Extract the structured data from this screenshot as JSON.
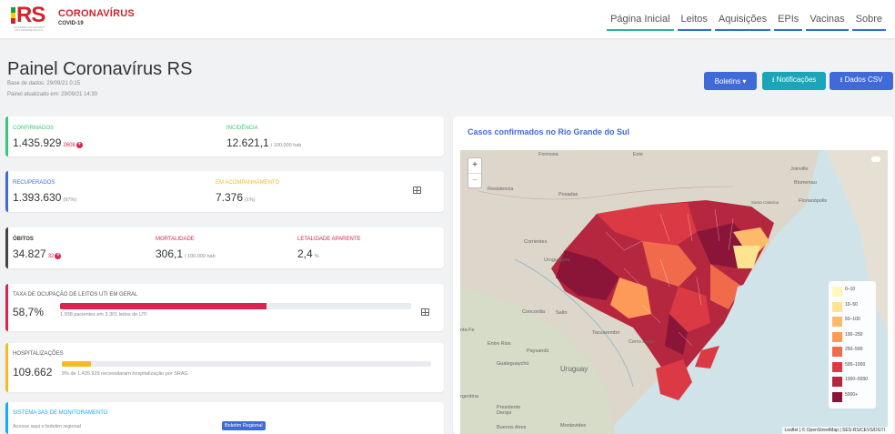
{
  "header": {
    "logo_text": "RS",
    "logo_sub": "GOVERNO DO ESTADO RIO GRANDE DO SUL",
    "brand_title": "CORONAVÍRUS",
    "brand_sub": "COVID-19",
    "nav": [
      "Página Inicial",
      "Leitos",
      "Aquisições",
      "EPIs",
      "Vacinas",
      "Sobre"
    ],
    "active_nav": "Página Inicial"
  },
  "page": {
    "title": "Painel Coronavírus RS",
    "base_dados": "Base de dados: 29/09/21 0:15",
    "atualizado": "Painel atualizado em: 29/09/21 14:30"
  },
  "buttons": {
    "boletins": "Boletins ▾",
    "notificacoes": "⭳ Notificações",
    "dados_csv": "⭳ Dados CSV"
  },
  "cards": {
    "confirmados": {
      "label": "CONFIRMADOS",
      "value": "1.435.929",
      "increment": "2608"
    },
    "incidencia": {
      "label": "INCIDÊNCIA",
      "value": "12.621,1",
      "unit": "/ 100.000 hab"
    },
    "recuperados": {
      "label": "RECUPERADOS",
      "value": "1.393.630",
      "pct": "(97%)"
    },
    "acompanhamento": {
      "label": "EM ACOMPANHAMENTO",
      "value": "7.376",
      "pct": "(1%)"
    },
    "obitos": {
      "label": "ÓBITOS",
      "value": "34.827",
      "increment": "32"
    },
    "mortalidade": {
      "label": "MORTALIDADE",
      "value": "306,1",
      "unit": "/ 100.000 hab"
    },
    "letalidade": {
      "label": "LETALIDADE APARENTE",
      "value": "2,4",
      "unit": "%"
    },
    "uti": {
      "label": "TAXA DE OCUPAÇÃO DE LEITOS UTI EM GERAL",
      "value": "58,7%",
      "desc": "1.938 pacientes em 3.301 leitos de UTI",
      "fill": 0.587
    },
    "hosp": {
      "label": "HOSPITALIZAÇÕES",
      "value": "109.662",
      "desc": "8% de 1.435.929 necessitaram hospitalização por SRAG",
      "fill": 0.08
    },
    "sas": {
      "label": "SISTEMA 3AS DE MONITORAMENTO",
      "desc": "Acesse aqui o boletim regional",
      "button": "Boletim Regional"
    }
  },
  "map": {
    "title": "Casos confirmados no Rio Grande do Sul",
    "zoom_in": "+",
    "zoom_out": "−",
    "places": [
      "Formosa",
      "Este",
      "Joinville",
      "Blumenau",
      "Resistencia",
      "Posadas",
      "Santa Catarina",
      "Florianópolis",
      "Corrientes",
      "Uruguaiana",
      "Concordia",
      "Salto",
      "nta Fe",
      "Entre Rios",
      "Paysandú",
      "Tacuarembó",
      "Cerro Largo",
      "Gualeguaychú",
      "Uruguay",
      "rgentina",
      "Presidente Derqui",
      "Buenos Aires",
      "Montevideo"
    ],
    "legend": [
      {
        "label": "0–10",
        "color": "#fff7bc"
      },
      {
        "label": "10–50",
        "color": "#fee391"
      },
      {
        "label": "50–100",
        "color": "#fdbb6a"
      },
      {
        "label": "100–250",
        "color": "#fd9a58"
      },
      {
        "label": "250–500",
        "color": "#f16a4c"
      },
      {
        "label": "500–1000",
        "color": "#db3a45"
      },
      {
        "label": "1000–5000",
        "color": "#b5273f"
      },
      {
        "label": "5000+",
        "color": "#8a1538"
      }
    ],
    "attribution": "Leaflet | © OpenStreetMap | SES-RS/CEVS/DGTI"
  }
}
